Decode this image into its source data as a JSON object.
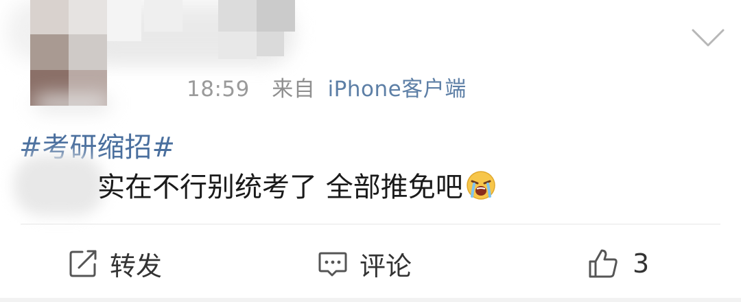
{
  "post": {
    "time": "18:59",
    "source_prefix": "来自",
    "source_client": "iPhone客户端",
    "hashtag": "#考研缩招#",
    "text": "实在不行别统考了 全部推免吧"
  },
  "actions": {
    "repost_label": "转发",
    "comment_label": "评论",
    "like_count": "3"
  },
  "icons": {
    "menu": "chevron-down-icon",
    "repost": "repost-icon",
    "comment": "comment-icon",
    "like": "thumbs-up-icon",
    "emoji": "crying-emoji-icon"
  },
  "colors": {
    "link": "#4a6f9e",
    "meta": "#8f8f8f",
    "text": "#1a1a1a"
  }
}
